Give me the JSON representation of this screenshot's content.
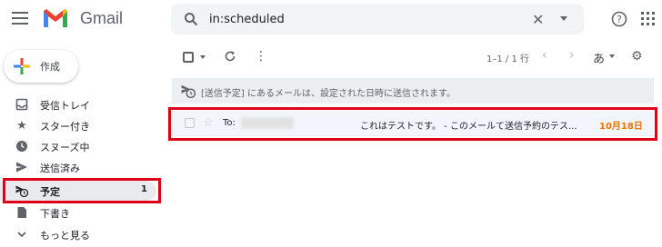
{
  "app": {
    "brand": "Gmail"
  },
  "search": {
    "query": "in:scheduled",
    "clear_glyph": "✕"
  },
  "compose": {
    "label": "作成"
  },
  "sidebar": {
    "items": [
      {
        "label": "受信トレイ",
        "icon": "inbox-icon",
        "count": ""
      },
      {
        "label": "スター付き",
        "icon": "star-icon",
        "count": ""
      },
      {
        "label": "スヌーズ中",
        "icon": "clock-icon",
        "count": ""
      },
      {
        "label": "送信済み",
        "icon": "send-icon",
        "count": ""
      },
      {
        "label": "予定",
        "icon": "scheduled-send-icon",
        "count": "1"
      },
      {
        "label": "下書き",
        "icon": "draft-icon",
        "count": ""
      },
      {
        "label": "もっと見る",
        "icon": "chevron-down-icon",
        "count": ""
      }
    ]
  },
  "toolbar": {
    "page_range": "1–1 / 1 行",
    "ime": "あ"
  },
  "info": {
    "text": "[送信予定] にあるメールは、設定された日時に送信されます。"
  },
  "email": {
    "to_label": "To:",
    "subject": "これはテストです。 - このメールて送信予約のテス...",
    "date": "10月18日"
  },
  "colors": {
    "accent_red": "#e0001a",
    "date_orange": "#e37400",
    "selected_bg": "#e8eaed"
  }
}
